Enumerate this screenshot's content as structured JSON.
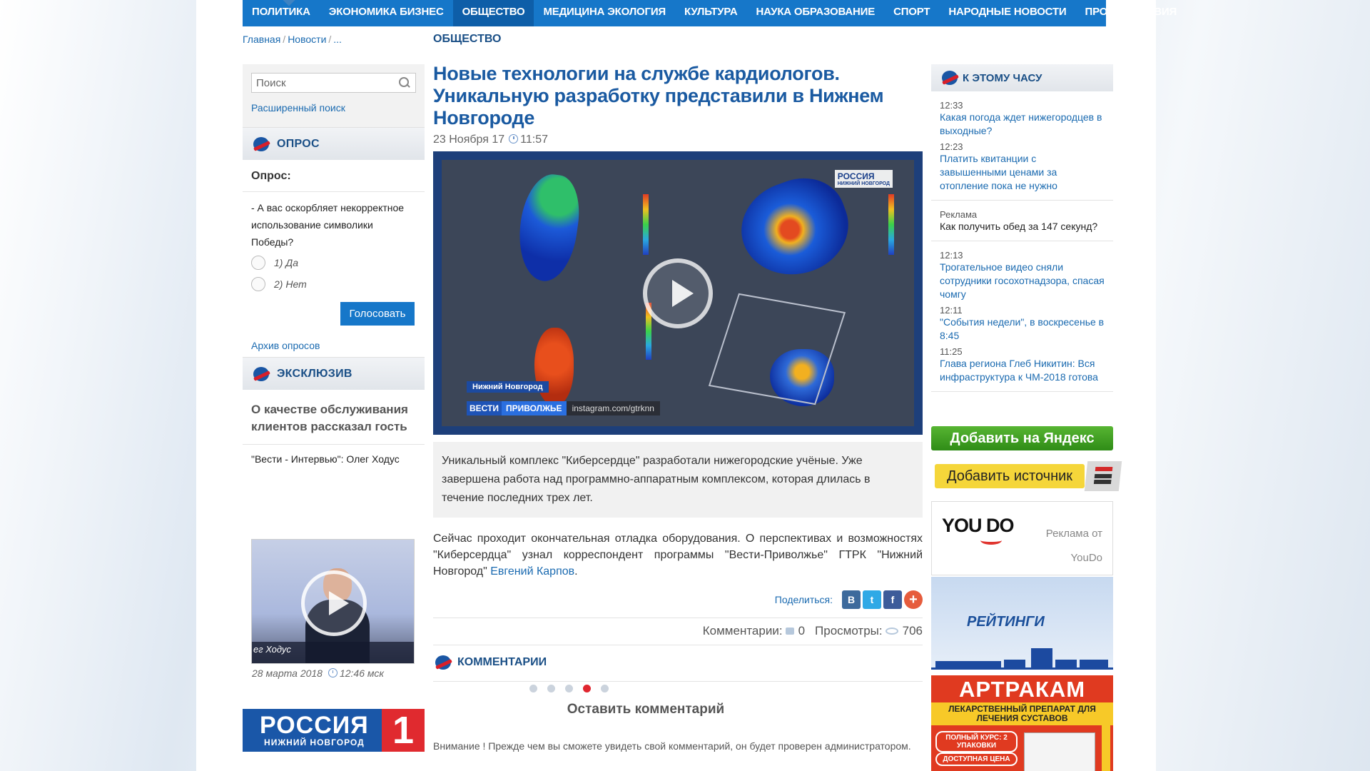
{
  "nav": {
    "items": [
      "ПОЛИТИКА",
      "ЭКОНОМИКА БИЗНЕС",
      "ОБЩЕСТВО",
      "МЕДИЦИНА ЭКОЛОГИЯ",
      "КУЛЬТУРА",
      "НАУКА ОБРАЗОВАНИЕ",
      "СПОРТ",
      "НАРОДНЫЕ НОВОСТИ",
      "ПРОИСШЕСТВИЯ"
    ],
    "active": "ОБЩЕСТВО"
  },
  "breadcrumb": {
    "home": "Главная",
    "news": "Новости",
    "more": "...",
    "section": "ОБЩЕСТВО"
  },
  "search": {
    "placeholder": "Поиск",
    "advanced": "Расширенный поиск"
  },
  "poll": {
    "header": "ОПРОС",
    "title": "Опрос:",
    "question": "- А вас оскорбляет некорректное использование символики Победы?",
    "options": [
      "1) Да",
      "2) Нет"
    ],
    "vote_label": "Голосовать",
    "archive": "Архив опросов"
  },
  "exclusive": {
    "header": "ЭКСКЛЮЗИВ",
    "headline": "О качестве обслуживания клиентов рассказал гость",
    "interview": "\"Вести - Интервью\": Олег Ходус",
    "video_caption": "ег Ходус",
    "video_date": "28 марта 2018",
    "video_time": "12:46 мск",
    "slides_total": 5,
    "slides_active": 4
  },
  "logo": {
    "name": "РОССИЯ",
    "region": "НИЖНИЙ НОВГОРОД",
    "number": "1"
  },
  "article": {
    "title": "Новые технологии на службе кардиологов. Уникальную разработку представили в Нижнем Новгороде",
    "date": "23 Ноября 17",
    "time": "11:57",
    "video": {
      "brand": "РОССИЯ",
      "brand_sub": "НИЖНИЙ НОВГОРОД",
      "location": "Нижний Новгород",
      "show_a": "ВЕСТИ",
      "show_b": "ПРИВОЛЖЬЕ",
      "instagram": "instagram.com/gtrknn"
    },
    "lead": "Уникальный комплекс \"Киберсердце\" разработали нижегородские учёные. Уже завершена работа над программно-аппаратным комплексом, которая длилась в течение последних трех лет.",
    "body": "Сейчас проходит окончательная отладка оборудования. О перспективах и возможностях \"Киберсердца\" узнал корреспондент программы \"Вести-Приволжье\" ГТРК \"Нижний Новгород\" ",
    "author": "Евгений Карпов",
    "share_label": "Поделиться:",
    "comments_label": "Комментарии:",
    "comments_count": "0",
    "views_label": "Просмотры:",
    "views_count": "706"
  },
  "comments": {
    "header": "КОММЕНТАРИИ",
    "leave": "Оставить комментарий",
    "note": "Внимание ! Прежде чем вы сможете увидеть свой комментарий, он будет проверен администратором."
  },
  "sidebar_news": {
    "header": "К ЭТОМУ ЧАСУ",
    "items": [
      {
        "time": "12:33",
        "text": "Какая погода ждет нижегородцев в выходные?"
      },
      {
        "time": "12:23",
        "text": "Платить квитанции с завышенными ценами за отопление пока не нужно"
      },
      {
        "time": "Реклама",
        "text": "Как получить обед за 147 секунд?"
      },
      {
        "time": "12:13",
        "text": "Трогательное видео сняли сотрудники госохотнадзора, спасая чомгу"
      },
      {
        "time": "12:11",
        "text": "\"События недели\", в воскресенье в 8:45"
      },
      {
        "time": "11:25",
        "text": "Глава региона Глеб Никитин: Вся инфраструктура к ЧМ-2018 готова"
      }
    ]
  },
  "ads": {
    "yandex": "Добавить на Яндекс",
    "source": "Добавить источник",
    "youdo_logo": "YOU DO",
    "youdo_label": "Реклама от",
    "youdo_name": "YouDo",
    "ratings": "РЕЙТИНГИ",
    "artrakam_name": "АРТРАКАМ",
    "artrakam_sub": "ЛЕКАРСТВЕННЫЙ ПРЕПАРАТ ДЛЯ ЛЕЧЕНИЯ СУСТАВОВ",
    "artrakam_pill1": "ПОЛНЫЙ КУРС: 2 УПАКОВКИ",
    "artrakam_pill2": "ДОСТУПНАЯ ЦЕНА"
  }
}
